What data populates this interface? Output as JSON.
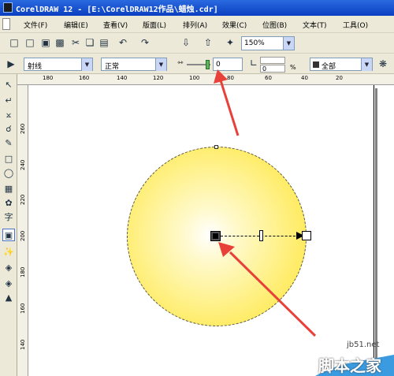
{
  "window": {
    "title": "CorelDRAW 12 - [E:\\CorelDRAW12作品\\蜡烛.cdr]"
  },
  "menubar": {
    "items": [
      {
        "label": "文件(F)"
      },
      {
        "label": "编辑(E)"
      },
      {
        "label": "查看(V)"
      },
      {
        "label": "版面(L)"
      },
      {
        "label": "排列(A)"
      },
      {
        "label": "效果(C)"
      },
      {
        "label": "位图(B)"
      },
      {
        "label": "文本(T)"
      },
      {
        "label": "工具(O)"
      }
    ]
  },
  "toolbar": {
    "zoom": "150%",
    "icons": [
      "new-icon",
      "open-icon",
      "save-icon",
      "print-icon",
      "cut-icon",
      "copy-icon",
      "paste-icon",
      "undo-icon",
      "redo-icon",
      "import-icon",
      "export-icon",
      "app-launcher-icon"
    ]
  },
  "property_bar": {
    "fill_type": "射线",
    "fill_mode": "正常",
    "midpoint": "0",
    "angle_value": "0",
    "percent_sign": "%",
    "edge_scope": "全部"
  },
  "rulers": {
    "horizontal_labels": [
      "180",
      "160",
      "140",
      "120",
      "100",
      "80",
      "60",
      "40",
      "20"
    ],
    "vertical_labels": [
      "260",
      "240",
      "220",
      "200",
      "180",
      "160",
      "140"
    ]
  },
  "watermark": {
    "site": "jb51.net",
    "name": "脚本之家"
  },
  "colors": {
    "title_bar": "#0a3fc0",
    "chrome": "#ece9d8",
    "fill_center": "#ffffff",
    "fill_edge": "#ffe43c",
    "annotation_arrow": "#e8413a"
  }
}
